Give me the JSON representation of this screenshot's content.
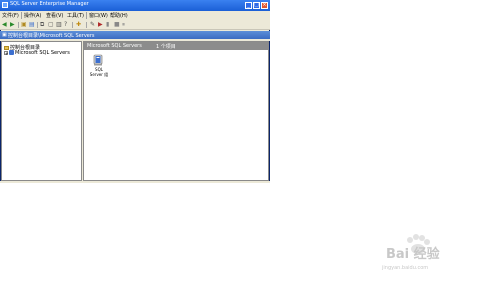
{
  "window": {
    "title": "SQL Server Enterprise Manager",
    "minimize_glyph": "_",
    "maximize_glyph": "□",
    "close_glyph": "×"
  },
  "menubar": {
    "items": [
      "文件(F)",
      "操作(A)",
      "查看(V)",
      "工具(T)",
      "窗口(W)",
      "帮助(H)"
    ]
  },
  "toolbar": {
    "icons": [
      "back-icon",
      "forward-icon",
      "up-folder-icon",
      "show-tree-icon",
      "properties-icon",
      "new-icon",
      "export-icon",
      "help-icon",
      "new-server-icon",
      "wizard-icon",
      "run-icon",
      "start-icon",
      "stop-icon",
      "pause-icon"
    ]
  },
  "address": {
    "text": "控制台根目录\\Microsoft SQL Servers"
  },
  "tree": {
    "root": "控制台根目录",
    "child": "Microsoft SQL Servers",
    "expander": "+"
  },
  "right_pane": {
    "header_title": "Microsoft SQL Servers",
    "item_count": "1 个项目",
    "items": [
      {
        "label": "SQL Server 组"
      }
    ]
  },
  "watermark": {
    "brand": "Bai 经验",
    "url": "jingyan.baidu.com"
  },
  "colors": {
    "titlebar": "#1b5fd6",
    "close": "#e0572f",
    "address_bar": "#3b6cc2",
    "header_gray": "#8c8c8c"
  }
}
